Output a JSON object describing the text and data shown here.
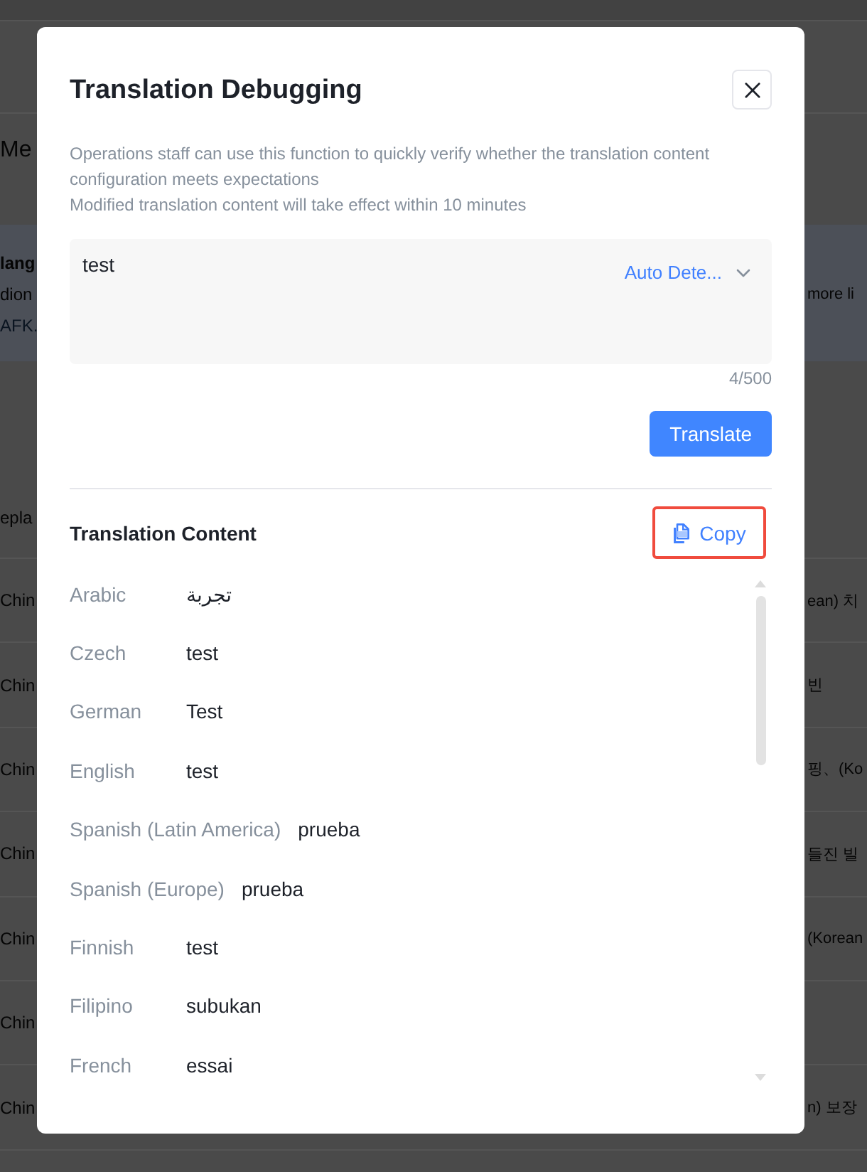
{
  "background_page": {
    "heading": "Me",
    "notice": {
      "title": "lang",
      "lines": [
        "dion",
        "AFK."
      ],
      "side_text": "more li"
    },
    "table": {
      "column_header": "epla",
      "rows": [
        {
          "column_1": "Chin",
          "column_2": "ean) 치"
        },
        {
          "column_1": "Chin",
          "column_2": "빈"
        },
        {
          "column_1": "Chin",
          "column_2": "핑、(Ko"
        },
        {
          "column_1": "Chin",
          "column_2": "들진 빌"
        },
        {
          "column_1": "Chin",
          "column_2": "(Korean"
        },
        {
          "column_1": "Chin"
        },
        {
          "column_1": "Chin",
          "column_2": "n) 보장"
        }
      ]
    }
  },
  "dialog": {
    "title": "Translation Debugging",
    "description": [
      "Operations staff can use this function to quickly verify whether the translation content configuration meets expectations",
      "Modified translation content will take effect within 10 minutes"
    ],
    "source": {
      "value": "test",
      "language": "Auto Dete...",
      "counter": "4/500"
    },
    "translate_button": "Translate",
    "result": {
      "title": "Translation Content",
      "copy_button": {
        "label": "Copy",
        "highlighted": true
      },
      "rows": [
        {
          "language": "Arabic",
          "text": "تجربة"
        },
        {
          "language": "Czech",
          "text": "test"
        },
        {
          "language": "German",
          "text": "Test"
        },
        {
          "language": "English",
          "text": "test"
        },
        {
          "language": "Spanish (Latin America)",
          "text": "prueba"
        },
        {
          "language": "Spanish (Europe)",
          "text": "prueba"
        },
        {
          "language": "Finnish",
          "text": "test"
        },
        {
          "language": "Filipino",
          "text": "subukan"
        },
        {
          "language": "French",
          "text": "essai"
        }
      ]
    }
  }
}
